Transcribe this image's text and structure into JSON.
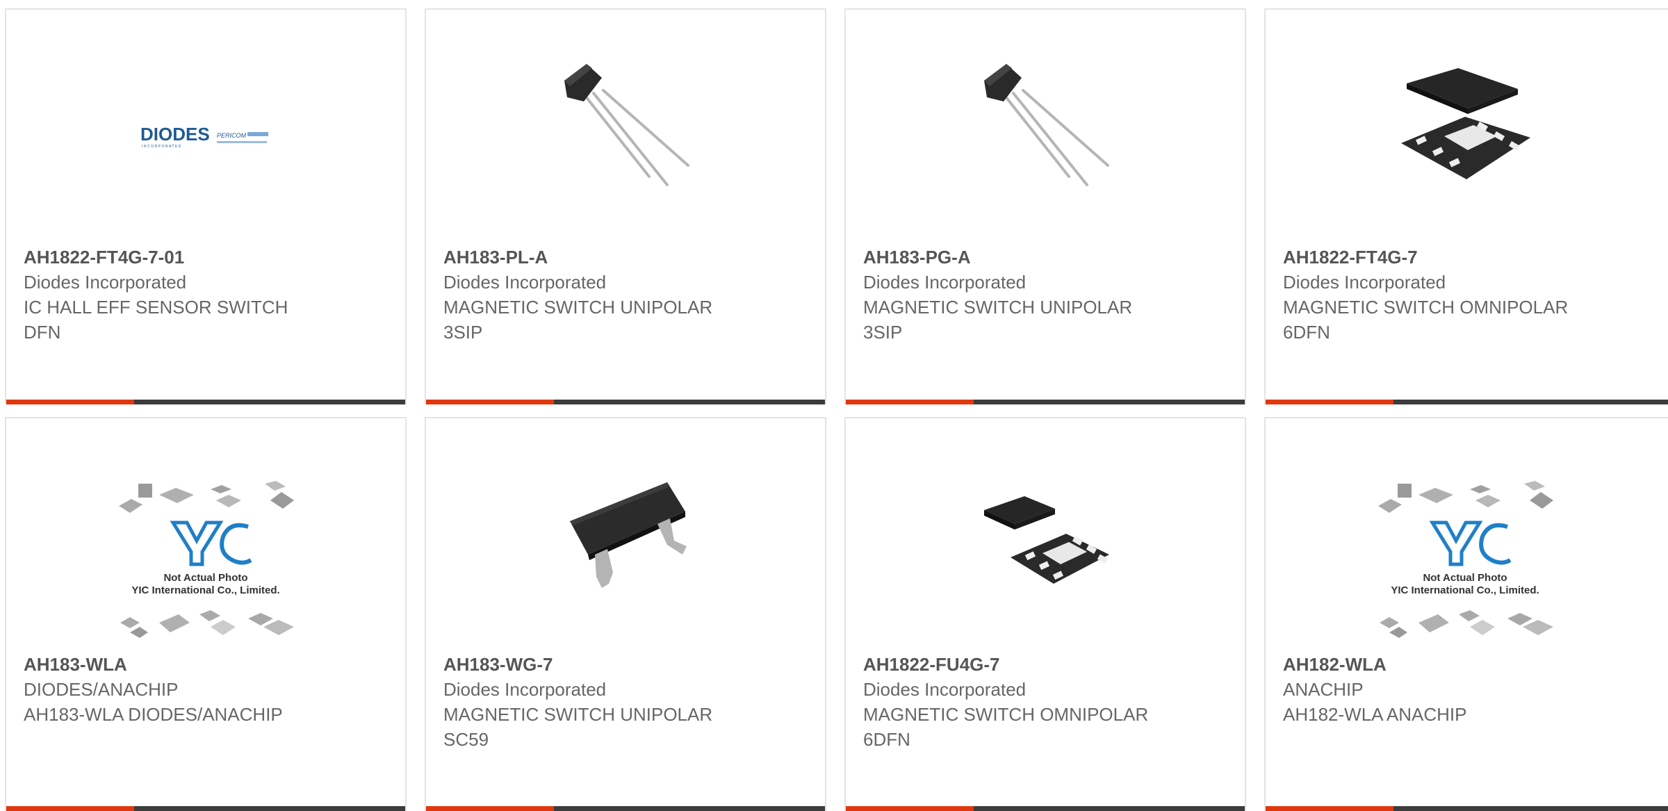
{
  "colors": {
    "accent": "#e0380e",
    "bar_dark": "#3c3c3c",
    "text_bold": "#555555",
    "text": "#666666",
    "border": "#e4e4e4"
  },
  "products": [
    {
      "part_number": "AH1822-FT4G-7-01",
      "manufacturer": "Diodes Incorporated",
      "description": "IC HALL EFF SENSOR SWITCH DFN",
      "image": "diodes-pericom-logo",
      "logo_text": "DIODES",
      "logo_subtext": "INCORPORATED",
      "logo_text2": "PERICOM"
    },
    {
      "part_number": "AH183-PL-A",
      "manufacturer": "Diodes Incorporated",
      "description": "MAGNETIC SWITCH UNIPOLAR 3SIP",
      "image": "to92-3sip-package"
    },
    {
      "part_number": "AH183-PG-A",
      "manufacturer": "Diodes Incorporated",
      "description": "MAGNETIC SWITCH UNIPOLAR 3SIP",
      "image": "to92-3sip-package"
    },
    {
      "part_number": "AH1822-FT4G-7",
      "manufacturer": "Diodes Incorporated",
      "description": "MAGNETIC SWITCH OMNIPOLAR 6DFN",
      "image": "dfn6-package"
    },
    {
      "part_number": "AH183-WLA",
      "manufacturer": "DIODES/ANACHIP",
      "description": "AH183-WLA DIODES/ANACHIP",
      "image": "yic-placeholder",
      "placeholder_line1": "Not Actual Photo",
      "placeholder_line2": "YIC International Co., Limited."
    },
    {
      "part_number": "AH183-WG-7",
      "manufacturer": "Diodes Incorporated",
      "description": "MAGNETIC SWITCH UNIPOLAR SC59",
      "image": "sc59-package"
    },
    {
      "part_number": "AH1822-FU4G-7",
      "manufacturer": "Diodes Incorporated",
      "description": "MAGNETIC SWITCH OMNIPOLAR 6DFN",
      "image": "dfn6-package"
    },
    {
      "part_number": "AH182-WLA",
      "manufacturer": "ANACHIP",
      "description": "AH182-WLA ANACHIP",
      "image": "yic-placeholder",
      "placeholder_line1": "Not Actual Photo",
      "placeholder_line2": "YIC International Co., Limited."
    }
  ]
}
